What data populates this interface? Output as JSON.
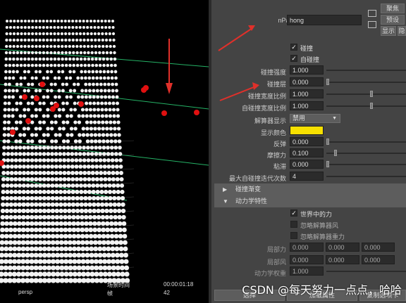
{
  "viewport": {
    "camera": "persp",
    "time_label": "00:00:01:18",
    "frame": "42",
    "hud_label_1": "场景时间",
    "hud_label_2": "帧"
  },
  "header": {
    "node_label": "nParticle:",
    "node_value": "hong",
    "focus_button": "聚焦",
    "presets_button": "预设",
    "show_button": "显示",
    "hide_button": "隐"
  },
  "collisions": {
    "collide_label": "碰撞",
    "collide_checked": true,
    "self_collide_label": "自碰撞",
    "self_collide_checked": true,
    "strength_label": "碰撞强度",
    "strength_value": "1.000",
    "layer_label": "碰撞层",
    "layer_value": "0.000",
    "width_scale_label": "碰撞宽度比例",
    "width_scale_value": "1.000",
    "self_width_scale_label": "自碰撞宽度比例",
    "self_width_scale_value": "1.000",
    "solver_display_label": "解算器显示",
    "solver_display_value": "禁用",
    "display_color_label": "显示颜色",
    "display_color": "#f7e000",
    "bounce_label": "反弹",
    "bounce_value": "0.000",
    "friction_label": "摩擦力",
    "friction_value": "0.100",
    "stickiness_label": "粘滞",
    "stickiness_value": "0.000",
    "max_iterations_label": "最大自碰撞迭代次数",
    "max_iterations_value": "4"
  },
  "sections": {
    "collision_ramps": "碰撞渐变",
    "dynamic_properties": "动力学特性"
  },
  "dynamics": {
    "world_force_label": "世界中的力",
    "world_force_checked": true,
    "ignore_wind_label": "忽略解算器风",
    "ignore_wind_checked": false,
    "ignore_gravity_label": "忽略解算器重力",
    "ignore_gravity_checked": false,
    "local_force_label": "局部力",
    "local_force": [
      "0.000",
      "0.000",
      "0.000"
    ],
    "local_wind_label": "局部风",
    "local_wind": [
      "0.000",
      "0.000",
      "0.000"
    ],
    "dynamic_weight_label": "动力学权重",
    "dynamic_weight_value": "1.000"
  },
  "footer": {
    "select_label": "选择",
    "load_attrs_label": "加载属性",
    "copy_tab_label": "复制选项卡"
  },
  "watermark": "CSDN @每天努力一点点，哈哈",
  "colors": {
    "arrow_red": "#e0302a",
    "grid_green": "#2fe080",
    "particle_red": "#e01010"
  }
}
